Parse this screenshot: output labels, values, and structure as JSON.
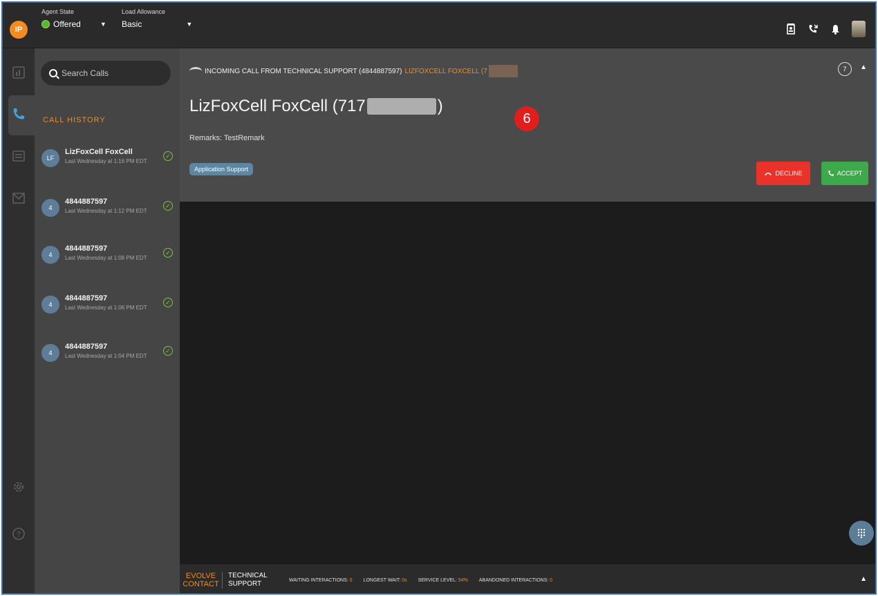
{
  "topbar": {
    "logo": "IP",
    "agent_state_label": "Agent State",
    "agent_state_value": "Offered",
    "load_label": "Load Allowance",
    "load_value": "Basic"
  },
  "sidebar": {
    "search_placeholder": "Search Calls",
    "history_title": "CALL HISTORY",
    "calls": [
      {
        "avatar": "LF",
        "name": "LizFoxCell FoxCell",
        "time": "Last Wednesday at 1:16 PM EDT"
      },
      {
        "avatar": "4",
        "name": "4844887597",
        "time": "Last Wednesday at 1:12 PM EDT"
      },
      {
        "avatar": "4",
        "name": "4844887597",
        "time": "Last Wednesday at 1:08 PM EDT"
      },
      {
        "avatar": "4",
        "name": "4844887597",
        "time": "Last Wednesday at 1:06 PM EDT"
      },
      {
        "avatar": "4",
        "name": "4844887597",
        "time": "Last Wednesday at 1:04 PM EDT"
      }
    ]
  },
  "incoming": {
    "banner": "INCOMING CALL FROM TECHNICAL SUPPORT (4844887597)",
    "banner_name": "LIZFOXCELL FOXCELL (7",
    "counter": "7",
    "caller_prefix": "LizFoxCell FoxCell (717",
    "caller_suffix": ")",
    "remarks": "Remarks: TestRemark",
    "tag": "Application Support",
    "badge": "6",
    "decline": "DECLINE",
    "accept": "ACCEPT"
  },
  "footer": {
    "brand_line1": "EVOLVE",
    "brand_line2": "CONTACT",
    "queue_line1": "TECHNICAL",
    "queue_line2": "SUPPORT",
    "stats": [
      {
        "label": "WAITING INTERACTIONS:",
        "value": "0"
      },
      {
        "label": "LONGEST WAIT:",
        "value": "0s"
      },
      {
        "label": "SERVICE LEVEL:",
        "value": "54%"
      },
      {
        "label": "ABANDONED INTERACTIONS:",
        "value": "0"
      }
    ]
  },
  "colors": {
    "accent": "#f28b22",
    "decline": "#e8322a",
    "accept": "#3ea94b",
    "status_green": "#5cb531"
  },
  "icons": [
    "search-icon",
    "phone-icon",
    "chat-icon",
    "mail-icon",
    "stats-icon",
    "settings-icon",
    "help-icon",
    "contacts-icon",
    "call-transfer-icon",
    "bell-icon",
    "dialpad-icon",
    "check-icon"
  ]
}
